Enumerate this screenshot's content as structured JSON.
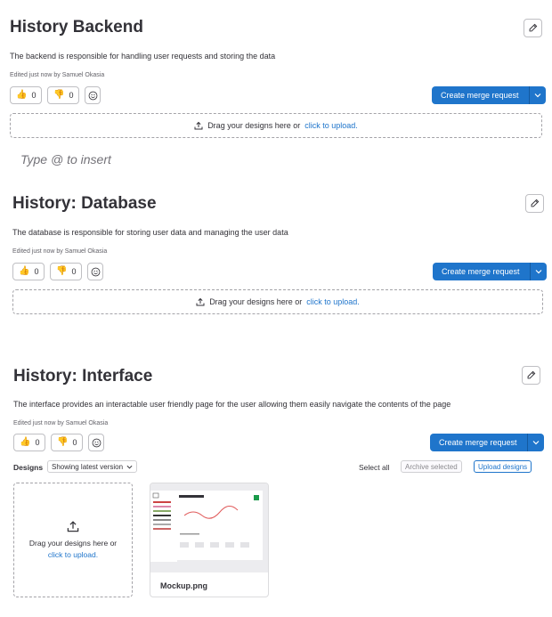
{
  "sections": [
    {
      "title": "History Backend",
      "description": "The backend is responsible for handling user requests and storing the data",
      "edited": "Edited just now by Samuel Okasia",
      "thumbs_up": "0",
      "thumbs_down": "0",
      "merge_label": "Create merge request",
      "drop_text": "Drag your designs here or",
      "drop_link": "click to upload."
    },
    {
      "title": "History: Database",
      "description": "The database is responsible for storing user data and managing the user data",
      "edited": "Edited just now by Samuel Okasia",
      "thumbs_up": "0",
      "thumbs_down": "0",
      "merge_label": "Create merge request",
      "drop_text": "Drag your designs here or",
      "drop_link": "click to upload."
    },
    {
      "title": "History: Interface",
      "description": "The interface provides an interactable user friendly page for the user allowing them easily navigate the contents of the page",
      "edited": "Edited just now by Samuel Okasia",
      "thumbs_up": "0",
      "thumbs_down": "0",
      "merge_label": "Create merge request"
    }
  ],
  "comment_placeholder": "Type @ to insert",
  "designs": {
    "label": "Designs",
    "version_select": "Showing latest version",
    "select_all": "Select all",
    "archive_selected": "Archive selected",
    "upload_designs": "Upload designs",
    "drop_line1": "Drag your designs here or",
    "drop_link": "click to upload.",
    "card_title": "Your Progress",
    "file_name": "Mockup.png"
  },
  "colors": {
    "primary": "#1f75cb",
    "text": "#333238",
    "border": "#bfbfc3"
  }
}
